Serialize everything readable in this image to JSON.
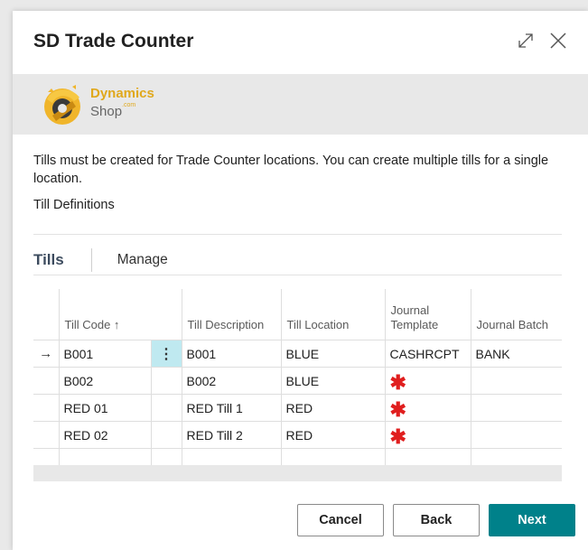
{
  "dialog": {
    "title": "SD Trade Counter"
  },
  "banner": {
    "brand_line1": "Dynamics",
    "brand_line2": "Shop",
    "brand_small": ".com"
  },
  "content": {
    "description": "Tills must be created for Trade Counter locations. You can create multiple tills for a single location.",
    "subheading": "Till Definitions"
  },
  "tabs": {
    "active": "Tills",
    "other": "Manage"
  },
  "grid": {
    "columns": [
      "Till Code ↑",
      "Till Description",
      "Till Location",
      "Journal Template",
      "Journal Batch"
    ],
    "rows": [
      {
        "till_code": "B001",
        "description": "B001",
        "location": "BLUE",
        "template": "CASHRCPT",
        "batch": "BANK",
        "selected": true
      },
      {
        "till_code": "B002",
        "description": "B002",
        "location": "BLUE",
        "template": "",
        "batch": "",
        "required": true
      },
      {
        "till_code": "RED 01",
        "description": "RED Till 1",
        "location": "RED",
        "template": "",
        "batch": "",
        "required": true
      },
      {
        "till_code": "RED 02",
        "description": "RED Till 2",
        "location": "RED",
        "template": "",
        "batch": "",
        "required": true
      }
    ],
    "row_selector_symbol": "→",
    "row_menu_symbol": "⋮",
    "required_symbol": "✱"
  },
  "buttons": {
    "cancel": "Cancel",
    "back": "Back",
    "next": "Next"
  },
  "colors": {
    "accent": "#00818a",
    "selected_cell": "#bfe9f0",
    "required": "#e01e1e",
    "brand": "#e0a81c"
  }
}
